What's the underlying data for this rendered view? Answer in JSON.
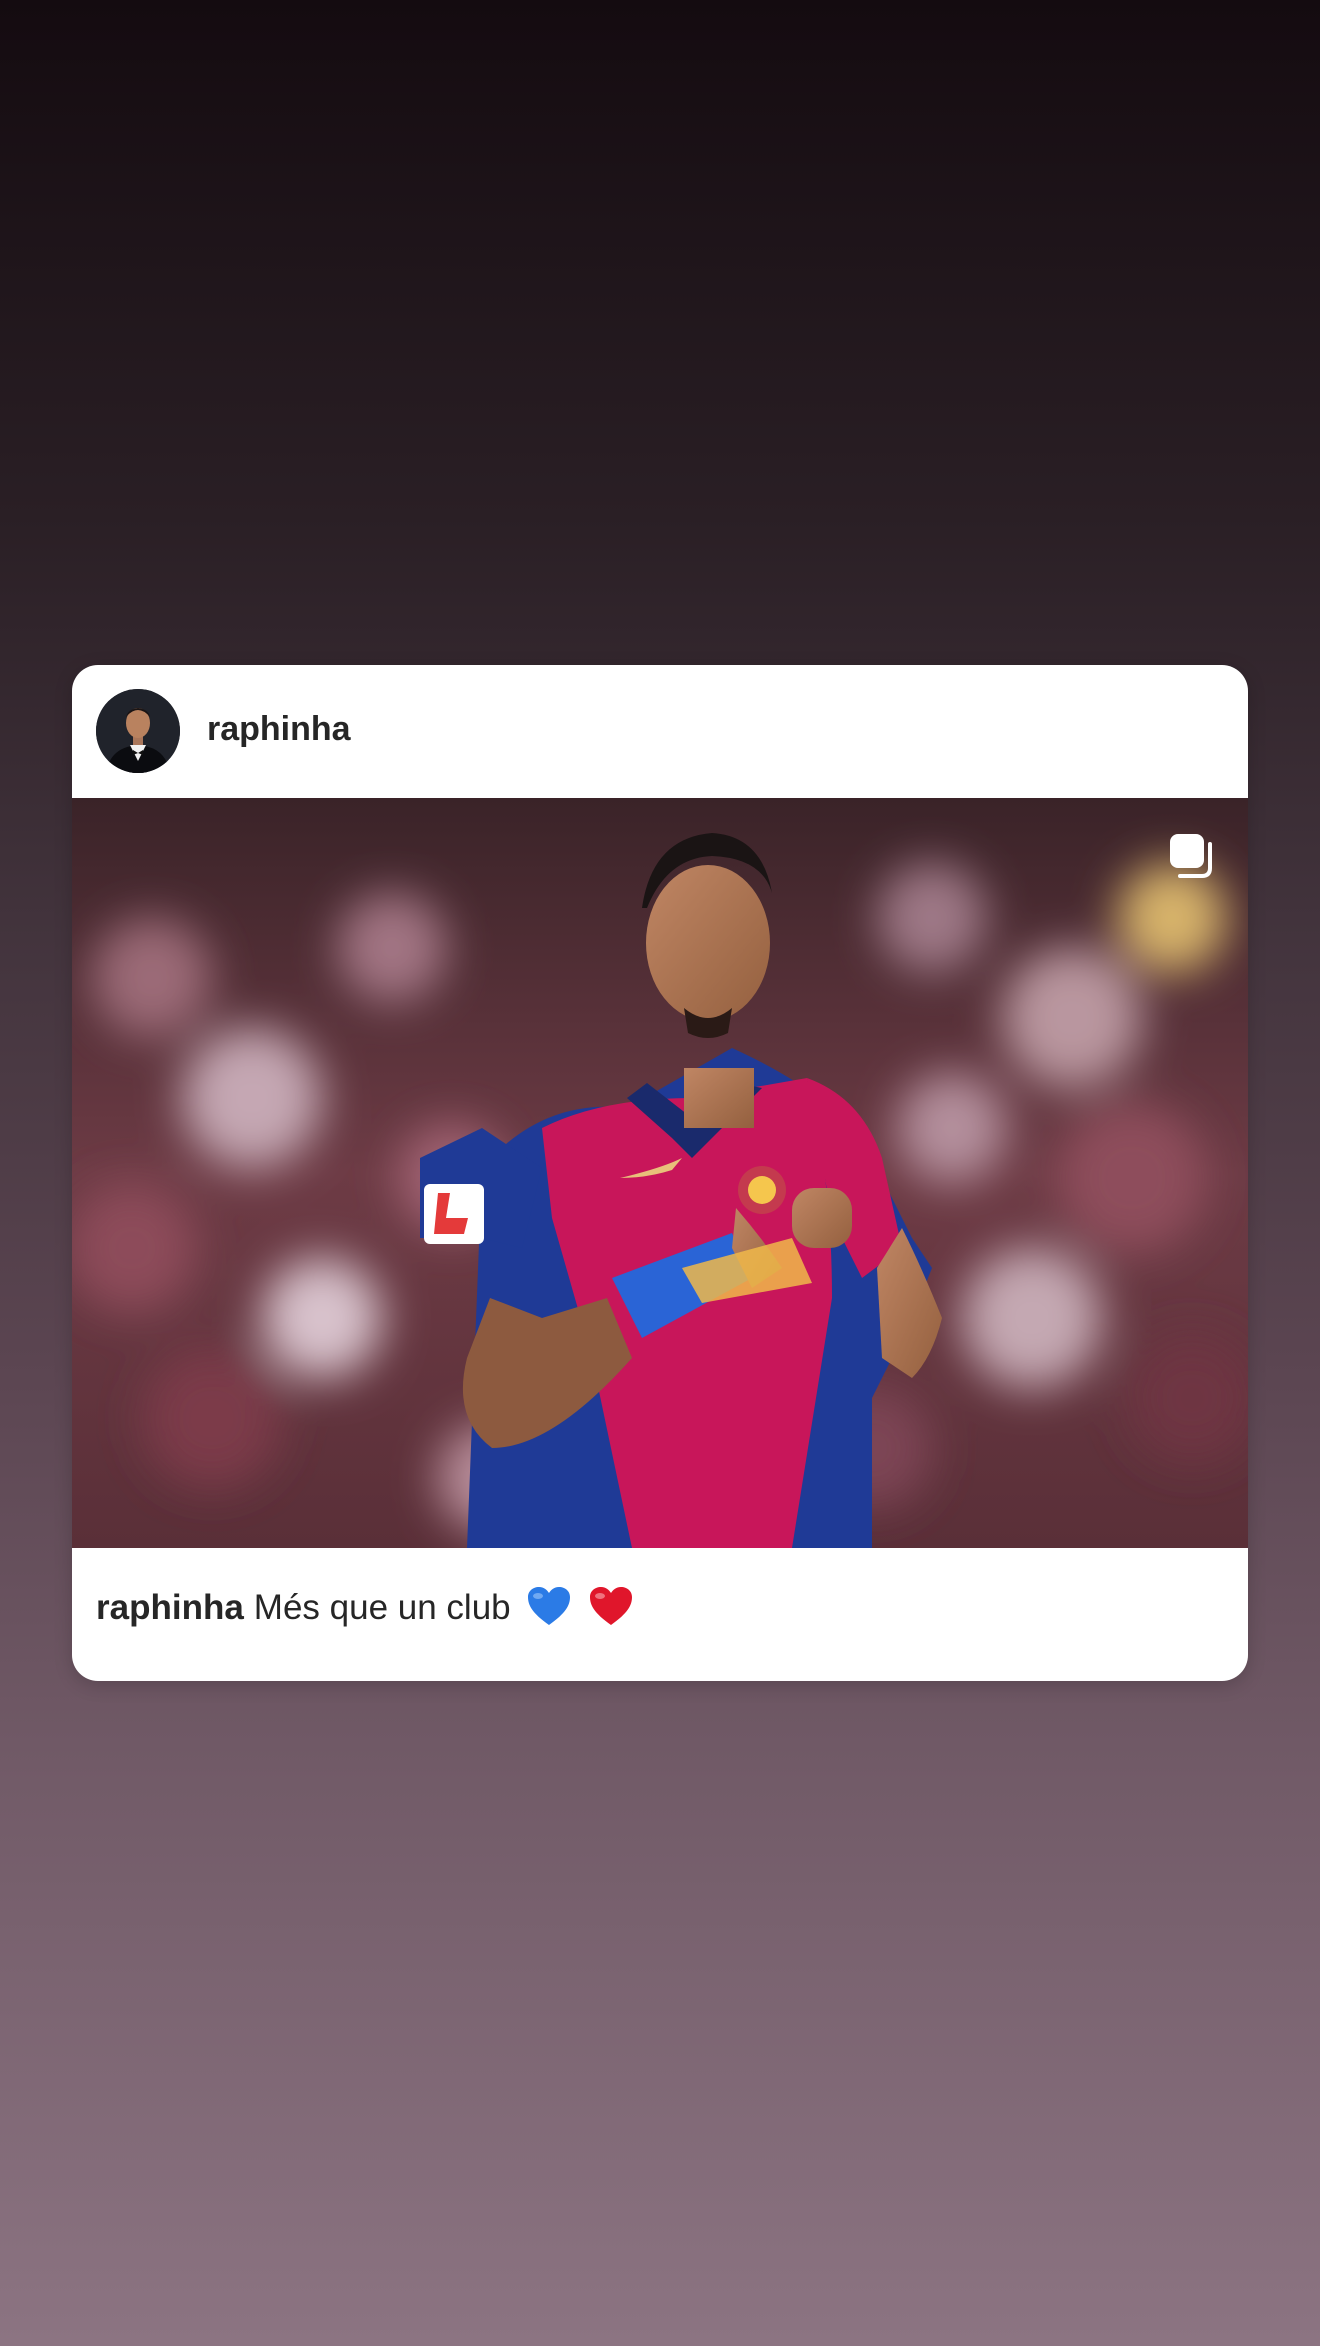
{
  "post": {
    "username": "raphinha",
    "caption": {
      "username": "raphinha",
      "text": "Més que un club"
    },
    "icons": {
      "avatar": "profile-photo",
      "multi_post": "carousel-icon",
      "emoji_1": "blue-heart-icon",
      "emoji_2": "red-heart-icon"
    }
  },
  "colors": {
    "blue_heart": "#2b7be6",
    "red_heart": "#e0162b",
    "jersey_blue": "#1f3a96",
    "jersey_red": "#c8165a"
  }
}
